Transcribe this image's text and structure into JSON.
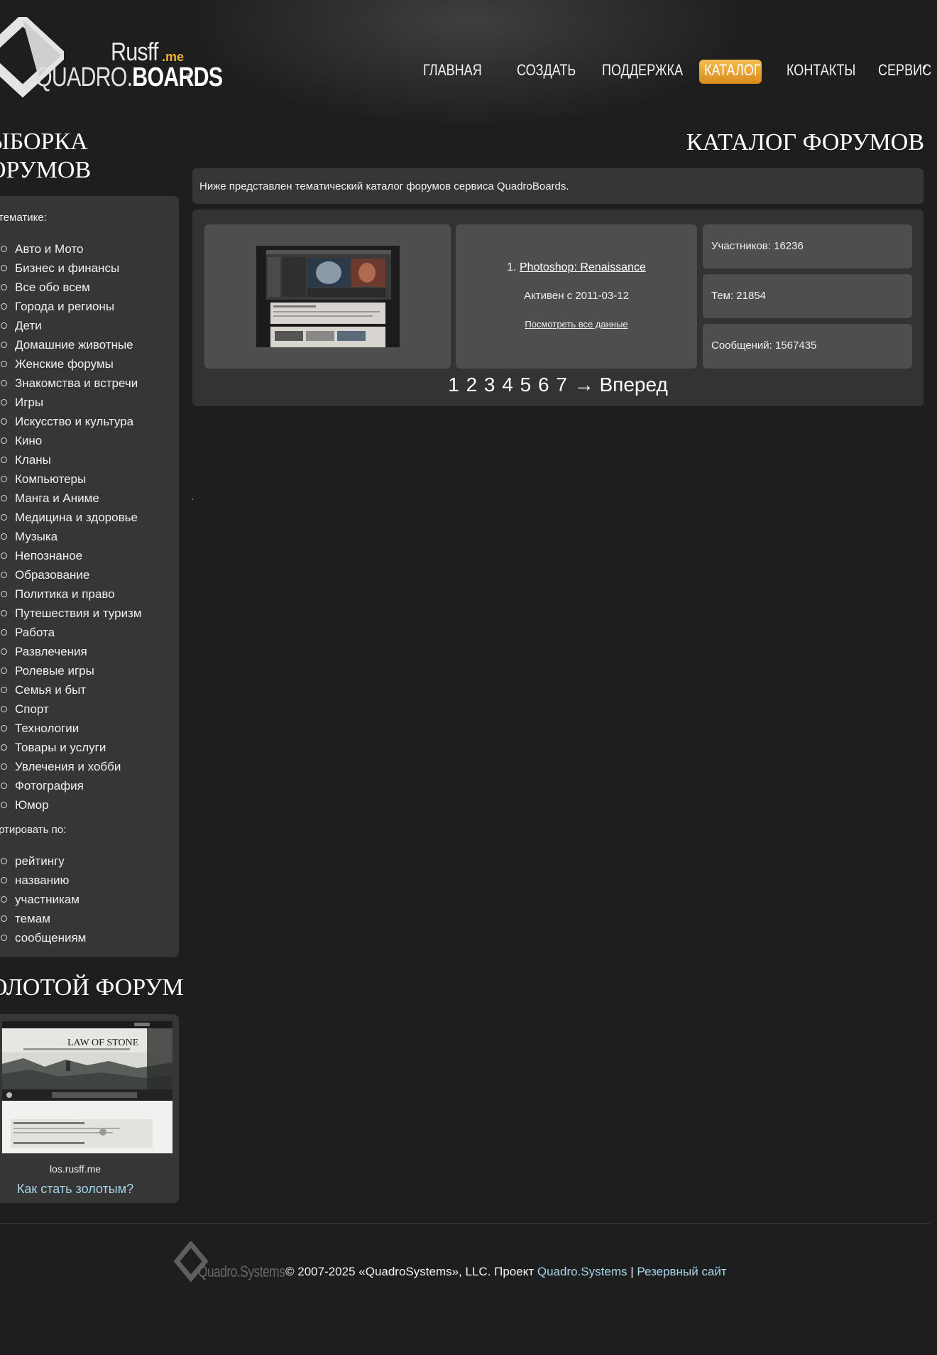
{
  "logo": {
    "line1": "Rusff",
    "suffix": ".me",
    "word1": "QUADRO.",
    "word2": "BOARDS",
    "reg": "®"
  },
  "nav": [
    {
      "label": "ГЛАВНАЯ"
    },
    {
      "label": "СОЗДАТЬ"
    },
    {
      "label": "ПОДДЕРЖКА"
    },
    {
      "label": "КАТАЛОГ",
      "active": true
    },
    {
      "label": "КОНТАКТЫ"
    },
    {
      "label": "СЕРВИС"
    }
  ],
  "sidebar": {
    "title_line1": "ЫБОРКА",
    "title_line2": "ОРУМОВ",
    "by_theme_label": "тематике:",
    "themes": [
      "Авто и Мото",
      "Бизнес и финансы",
      "Все обо всем",
      "Города и регионы",
      "Дети",
      "Домашние животные",
      "Женские форумы",
      "Знакомства и встречи",
      "Игры",
      "Искусство и культура",
      "Кино",
      "Кланы",
      "Компьютеры",
      "Манга и Аниме",
      "Медицина и здоровье",
      "Музыка",
      "Непознаное",
      "Образование",
      "Политика и право",
      "Путешествия и туризм",
      "Работа",
      "Развлечения",
      "Ролевые игры",
      "Семья и быт",
      "Спорт",
      "Технологии",
      "Товары и услуги",
      "Увлечения и хобби",
      "Фотография",
      "Юмор"
    ],
    "sort_label": "ртировать по:",
    "sort_options": [
      "рейтингу",
      "названию",
      "участникам",
      "темам",
      "сообщениям"
    ]
  },
  "gold": {
    "title": "ОЛОТОЙ ФОРУМ",
    "thumb_heading": "LAW OF STONE",
    "url": "los.rusff.me",
    "how_link": "Как стать золотым?"
  },
  "main": {
    "title": "КАТАЛОГ ФОРУМОВ",
    "intro": "Ниже представлен тематический каталог форумов сервиса QuadroBoards.",
    "forum": {
      "rank": "1.",
      "name": "Photoshop: Renaissance",
      "active_since": "Активен с 2011-03-12",
      "more_link": "Посмотреть все данные"
    },
    "stats": {
      "members": "Участников: 16236",
      "topics": "Тем: 21854",
      "posts": "Сообщений: 1567435"
    },
    "pages": [
      "1",
      "2",
      "3",
      "4",
      "5",
      "6",
      "7"
    ],
    "next": "→ Вперед"
  },
  "footer": {
    "logo_text": "Quadro.Systems",
    "copyright": "© 2007-2025 «QuadroSystems», LLC. Проект",
    "project_link": "Quadro.Systems",
    "separator": "|",
    "backup_link": "Резервный сайт"
  },
  "colors": {
    "accent": "#e9a12e",
    "link": "#a6d4ea",
    "background": "#1e1e1e"
  }
}
